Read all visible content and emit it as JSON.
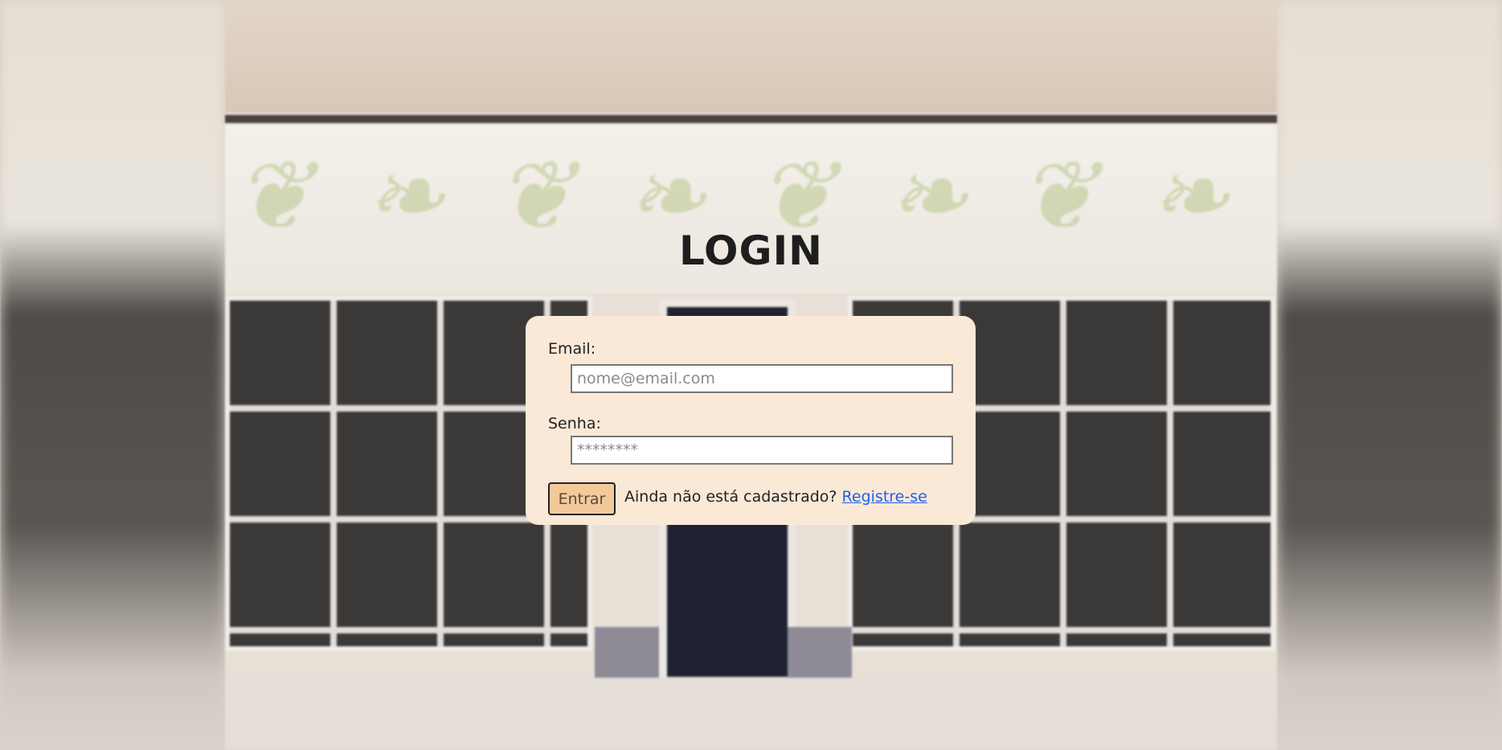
{
  "page": {
    "title": "LOGIN"
  },
  "form": {
    "email_label": "Email:",
    "email_placeholder": "nome@email.com",
    "password_label": "Senha:",
    "password_placeholder": "********",
    "submit_label": "Entrar",
    "register_prompt": "Ainda não está cadastrado?",
    "register_link": "Registre-se"
  },
  "colors": {
    "card_background": "#fae9d7",
    "button_background": "#f2c99b",
    "link": "#1f5ff0"
  }
}
